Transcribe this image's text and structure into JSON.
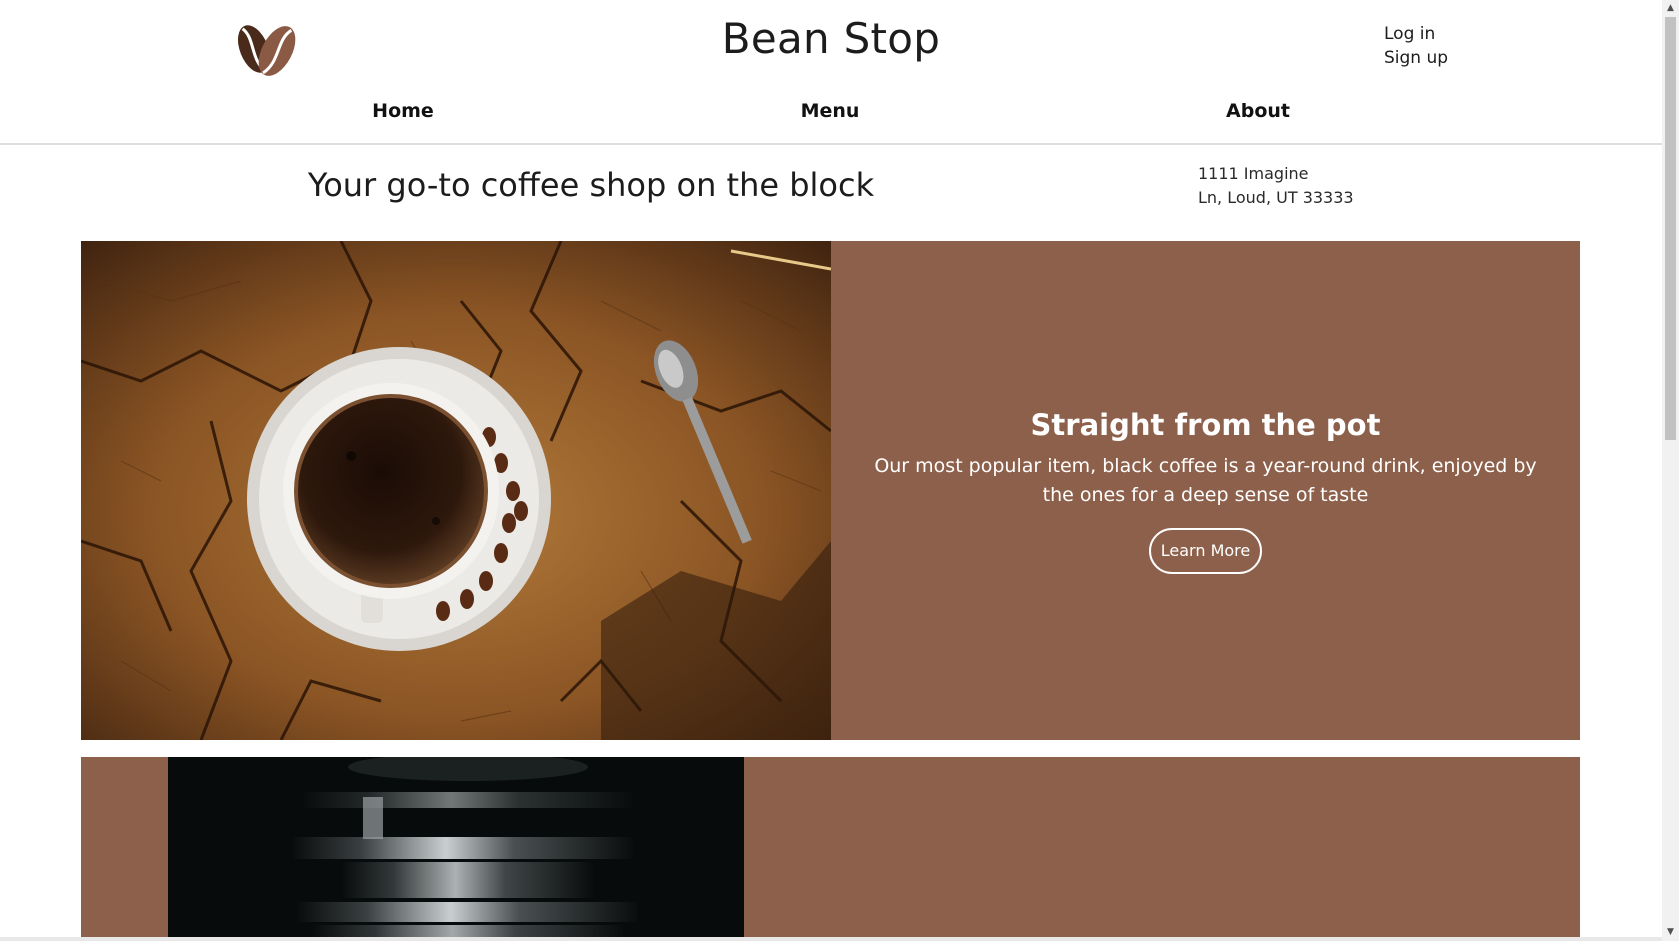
{
  "site": {
    "title": "Bean Stop",
    "logo_icon": "coffee-bean-heart-icon"
  },
  "auth": {
    "login_label": "Log in",
    "signup_label": "Sign up"
  },
  "nav": {
    "items": [
      {
        "label": "Home"
      },
      {
        "label": "Menu"
      },
      {
        "label": "About"
      }
    ]
  },
  "hero": {
    "tagline": "Your go-to coffee shop on the block",
    "address_line1": "1111 Imagine",
    "address_line2": "Ln, Loud, UT 33333"
  },
  "features": [
    {
      "title": "Straight from the pot",
      "description": "Our most popular item, black coffee is a year-round drink, enjoyed by the ones for a deep sense of taste",
      "button_label": "Learn More",
      "image_icon": "coffee-cup-on-wood-photo"
    },
    {
      "image_icon": "espresso-machine-photo"
    }
  ],
  "colors": {
    "feature_bg": "#8d604b",
    "bean_dark": "#4a2b1b",
    "bean_light": "#8a5a45"
  }
}
